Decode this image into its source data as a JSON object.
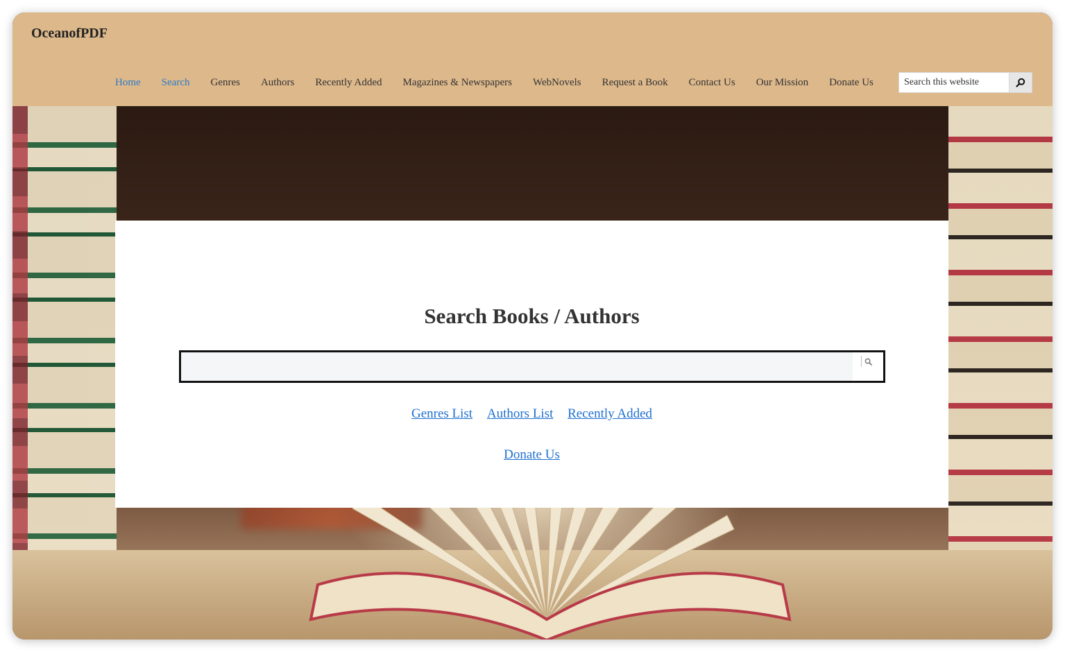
{
  "site": {
    "title": "OceanofPDF"
  },
  "nav": {
    "items": [
      {
        "label": "Home",
        "active": true
      },
      {
        "label": "Search",
        "active": true
      },
      {
        "label": "Genres",
        "active": false
      },
      {
        "label": "Authors",
        "active": false
      },
      {
        "label": "Recently Added",
        "active": false
      },
      {
        "label": "Magazines & Newspapers",
        "active": false
      },
      {
        "label": "WebNovels",
        "active": false
      },
      {
        "label": "Request a Book",
        "active": false
      },
      {
        "label": "Contact Us",
        "active": false
      },
      {
        "label": "Our Mission",
        "active": false
      },
      {
        "label": "Donate Us",
        "active": false
      }
    ]
  },
  "header_search": {
    "placeholder": "Search this website",
    "icon": "magnifier-icon"
  },
  "card": {
    "title": "Search Books / Authors",
    "search_value": "",
    "search_icon": "magnifier-icon",
    "links": [
      "Genres List",
      "Authors List",
      "Recently Added"
    ],
    "donate": "Donate Us"
  },
  "colors": {
    "header_bg": "#ddb88b",
    "nav_active": "#2a7ac9",
    "link": "#1d6fd0"
  }
}
